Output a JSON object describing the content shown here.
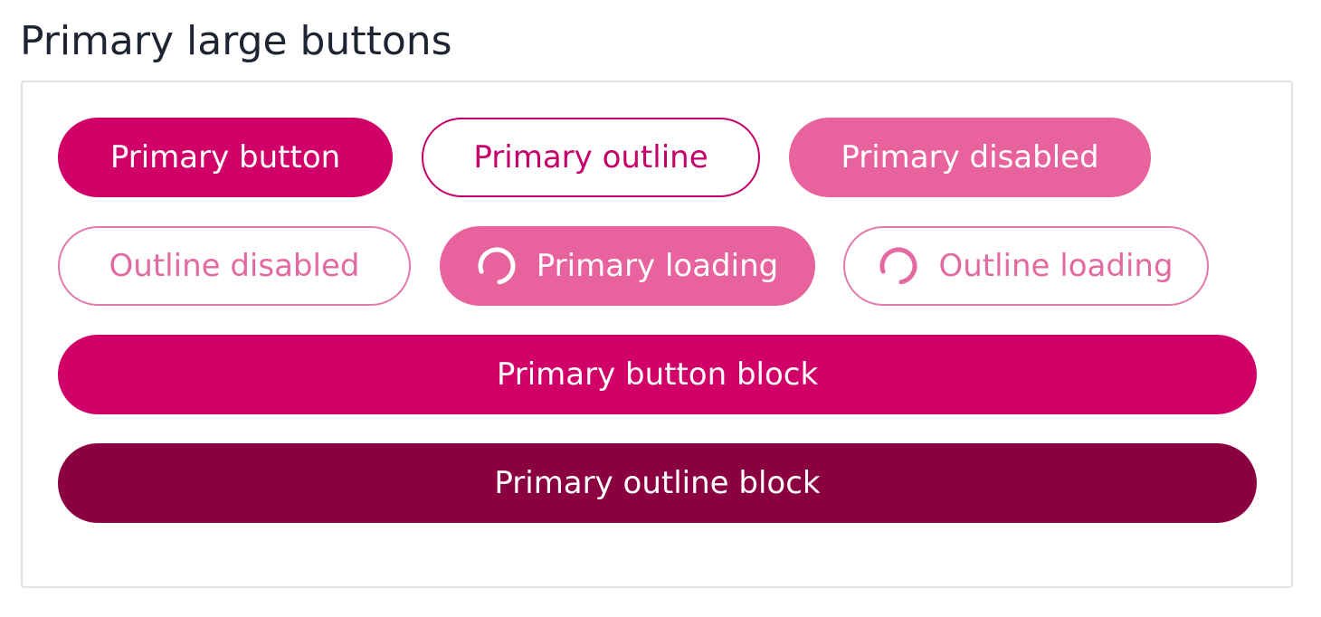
{
  "section": {
    "title": "Primary large buttons"
  },
  "buttons": {
    "primary": "Primary button",
    "outline": "Primary outline",
    "primary_disabled": "Primary disabled",
    "outline_disabled": "Outline disabled",
    "primary_loading": "Primary loading",
    "outline_loading": "Outline loading",
    "primary_block": "Primary button block",
    "outline_block": "Primary outline block"
  },
  "icons": {
    "primary_loading": "spinner-icon",
    "outline_loading": "spinner-icon"
  },
  "colors": {
    "primary": "#d10068",
    "primary_disabled": "#e8639d",
    "outline_border": "#c5006a",
    "dark_block": "#8a0040",
    "title_text": "#1f2433"
  }
}
